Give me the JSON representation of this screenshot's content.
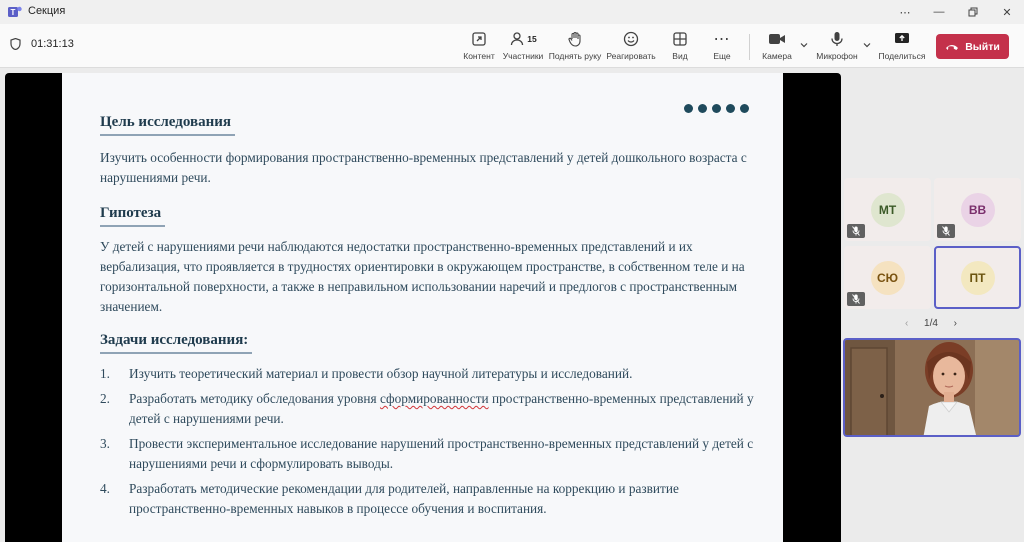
{
  "window": {
    "title": "Секция",
    "controls": [
      "more",
      "minimize",
      "restore",
      "close"
    ]
  },
  "toolbar": {
    "timer": "01:31:13",
    "content_label": "Контент",
    "participants_label": "Участники",
    "participants_count": "15",
    "raise_hand_label": "Поднять руку",
    "react_label": "Реагировать",
    "view_label": "Вид",
    "more_label": "Еще",
    "camera_label": "Камера",
    "mic_label": "Микрофон",
    "share_label": "Поделиться",
    "leave_label": "Выйти"
  },
  "slide": {
    "goal_heading": "Цель исследования",
    "goal_text": "Изучить особенности формирования пространственно-временных представлений у детей дошкольного возраста с нарушениями речи.",
    "hypothesis_heading": "Гипотеза",
    "hypothesis_text": "У детей с нарушениями речи наблюдаются недостатки пространственно-временных представлений и их вербализация, что проявляется в трудностях ориентировки в окружающем пространстве, в собственном теле и на горизонтальной поверхности, а также в неправильном использовании наречий и предлогов с пространственным значением.",
    "tasks_heading": "Задачи исследования:",
    "tasks": [
      {
        "num": "1.",
        "text": "Изучить теоретический материал и провести обзор научной литературы и исследований."
      },
      {
        "num": "2.",
        "pre": "Разработать методику обследования уровня ",
        "flagged": "сформированности",
        "post": " пространственно-временных представлений у детей с нарушениями речи."
      },
      {
        "num": "3.",
        "text": "Провести экспериментальное исследование нарушений пространственно-временных представлений у детей с нарушениями речи и сформулировать выводы."
      },
      {
        "num": "4.",
        "text": "Разработать методические рекомендации для родителей, направленные на коррекцию и развитие пространственно-временных навыков в процессе обучения и воспитания."
      }
    ]
  },
  "participants": [
    {
      "initials": "МТ",
      "avatar_bg": "#dfe6cf",
      "avatar_fg": "#3b5a27",
      "muted": true
    },
    {
      "initials": "ВВ",
      "avatar_bg": "#ead3e6",
      "avatar_fg": "#7a2f6c",
      "muted": true
    },
    {
      "initials": "СЮ",
      "avatar_bg": "#f5e2c0",
      "avatar_fg": "#7a5310",
      "muted": true
    },
    {
      "initials": "ПТ",
      "avatar_bg": "#f3e8c0",
      "avatar_fg": "#6b5510",
      "muted": false,
      "active": true
    }
  ],
  "pager": {
    "label": "1/4"
  },
  "colors": {
    "accent": "#5b5fc7",
    "leave": "#c4314b",
    "slide_heading": "#1f3b4d"
  }
}
